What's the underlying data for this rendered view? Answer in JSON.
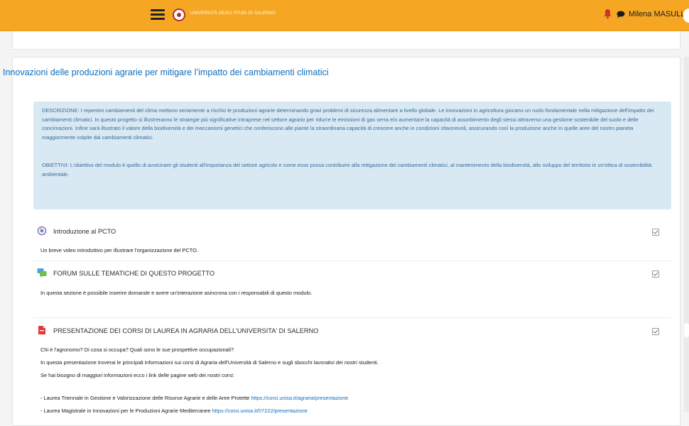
{
  "navbar": {
    "site_name": "UNIVERSITÀ DEGLI STUDI DI SALERNO",
    "user_name": "Milena MASULLO",
    "color": "#f5a623"
  },
  "course": {
    "title": "Innovazioni delle produzioni agrarie per mitigare l’impatto dei cambiamenti climatici",
    "description": "DESCRIZIONE: I repentini cambiamenti del clima mettono seriamente a rischio le produzioni agrarie determinando gravi problemi di sicurezza alimentare a livello globale.  Le innovazioni in agricoltura giocano un ruolo fondamentale nella mitigazione dell'impatto dei cambiamenti climatici. In questo progetto si illustreranno le strategie più significative intraprese nel settore agrario per ridurre le emissioni di gas serra  e/o aumentare la capacità di assorbimento degli stessi attraverso una gestione sostenibile del suolo e delle concimazioni. Infine sarà illustrato il valore della biodiversità e dei meccanismi genetici che conferiscono alle piante la straordinaria capacità di crescere anche in condizioni sfavorevoli, assicurando così la produzione anche in quelle aree del nostro pianeta maggiormente colpite dai cambiamenti climatici.",
    "objectives": "OBIETTIVI: L'obiettivo del modulo è quello di avvicinare gli studenti all'importanza  del settore agricolo e come esso possa contribuire alla mitigazione dei  cambiamenti climatici, al mantenimento della biodiversità, allo sviluppo  del territorio in un'ottica di sostenibilità ambientale."
  },
  "activities": [
    {
      "icon": "video-icon",
      "title": "Introduzione al PCTO",
      "desc": "Un breve video introduttivo per illustrare l'organizzazione del PCTO."
    },
    {
      "icon": "forum-icon",
      "title": "FORUM SULLE TEMATICHE DI QUESTO PROGETTO",
      "desc": "In questa sezione è possibile inserire domande e avere un'interazione asincrona con i responsabili di questo modulo."
    },
    {
      "icon": "pdf-icon",
      "title": "PRESENTAZIONE DEI CORSI DI LAUREA IN AGRARIA DELL'UNIVERSITA' DI SALERNO",
      "lines": [
        "Chi è l'agronomo? Di cosa si occupa? Quali sono le sue prospettive occupazionali?",
        "In questa presentazione troverai le principali informazioni sui corsi di Agraria dell'Università di Salerno e sugli sbocchi lavorativi dei nostri studenti.",
        "Se hai bisogno di maggiori informazioni ecco i link delle pagine web dei nostri corsi:"
      ],
      "link1_text": "- Laurea Triennale in Gestione e Valorizzazione delle Risorse Agrarie e delle Aree Protette ",
      "link1_url": "https://corsi.unisa.it/agraria/presentazione",
      "link2_text": "- Laurea Magistrale in Innovazioni per le Produzioni Agrarie Mediterranee ",
      "link2_url": "https://corsi.unisa.it/07222/presentazione"
    }
  ]
}
